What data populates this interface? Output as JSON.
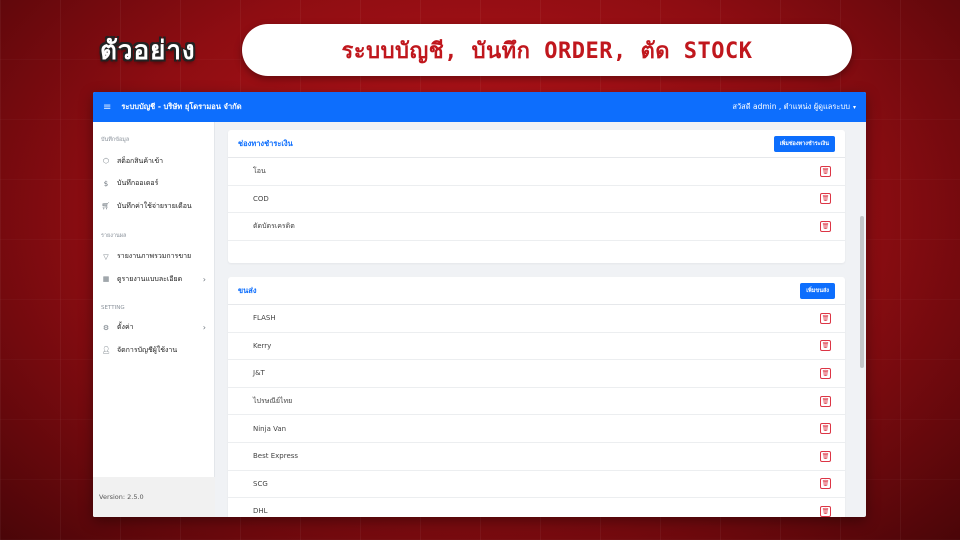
{
  "banner": {
    "example_label": "ตัวอย่าง",
    "headline": "ระบบบัญชี, บันทึก ORDER, ตัด STOCK"
  },
  "topbar": {
    "menu_icon": "hamburger-icon",
    "title": "ระบบบัญชี - บริษัท ยุโดรามอน จำกัด",
    "greeting": "สวัสดี admin , ตำแหน่ง ผู้ดูแลระบบ",
    "caret": "▾",
    "accent_color": "#0d6efd"
  },
  "sidebar": {
    "section1": "บันทึกข้อมูล",
    "section2": "รายงานผล",
    "section3": "SETTING",
    "items": [
      {
        "label": "สต็อกสินค้าเข้า",
        "icon": "box-icon"
      },
      {
        "label": "บันทึกออเดอร์",
        "icon": "dollar-icon"
      },
      {
        "label": "บันทึกค่าใช้จ่ายรายเดือน",
        "icon": "cart-icon"
      },
      {
        "label": "รายงานภาพรวมการขาย",
        "icon": "filter-icon"
      },
      {
        "label": "ดูรายงานแบบละเอียด",
        "icon": "grid-icon"
      },
      {
        "label": "ตั้งค่า",
        "icon": "gear-icon"
      },
      {
        "label": "จัดการบัญชีผู้ใช้งาน",
        "icon": "user-icon"
      }
    ],
    "chevron": "›",
    "version": "Version: 2.5.0"
  },
  "payment": {
    "title": "ช่องทางชำระเงิน",
    "add_button": "เพิ่มช่องทางชำระเงิน",
    "rows": [
      "โอน",
      "COD",
      "ตัดบัตรเครดิต"
    ]
  },
  "shipping": {
    "title": "ขนส่ง",
    "add_button": "เพิ่มขนส่ง",
    "rows": [
      "FLASH",
      "Kerry",
      "J&T",
      "ไปรษณีย์ไทย",
      "Ninja Van",
      "Best Express",
      "SCG",
      "DHL"
    ]
  },
  "delete_icon": "trash-icon"
}
